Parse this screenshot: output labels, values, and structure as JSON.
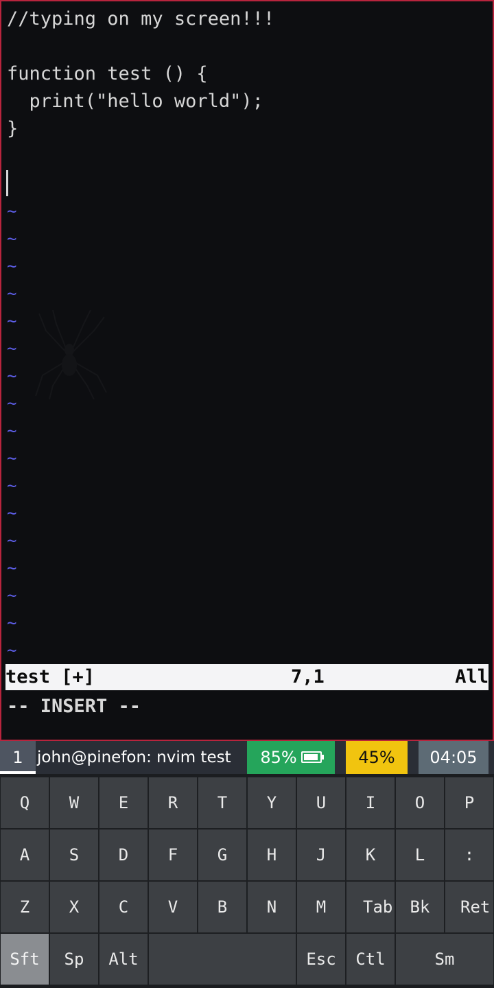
{
  "editor": {
    "lines": [
      "//typing on my screen!!!",
      "",
      "function test () {",
      "  print(\"hello world\");",
      "}",
      ""
    ],
    "tilde": "~",
    "status": {
      "filename": "test [+]",
      "position": "7,1",
      "scroll": "All"
    },
    "mode": "-- INSERT --"
  },
  "statusbar": {
    "workspace": "1",
    "window_title": "john@pinefon: nvim test",
    "battery": "85%",
    "cpu": "45%",
    "clock": "04:05"
  },
  "keyboard": {
    "row1": [
      "Q",
      "W",
      "E",
      "R",
      "T",
      "Y",
      "U",
      "I",
      "O",
      "P"
    ],
    "row2": [
      "A",
      "S",
      "D",
      "F",
      "G",
      "H",
      "J",
      "K",
      "L",
      ":"
    ],
    "row3": [
      "Z",
      "X",
      "C",
      "V",
      "B",
      "N",
      "M",
      "Tab",
      "Bk",
      "Ret"
    ],
    "row4": [
      "Sft",
      "Sp",
      "Alt",
      "",
      "Esc",
      "Ctl",
      "Sm"
    ]
  },
  "colors": {
    "window_border": "#b8243d",
    "tilde": "#5d5ee8",
    "battery_bg": "#25a55b",
    "cpu_bg": "#f1c40f",
    "clock_bg": "#5d6b75"
  }
}
